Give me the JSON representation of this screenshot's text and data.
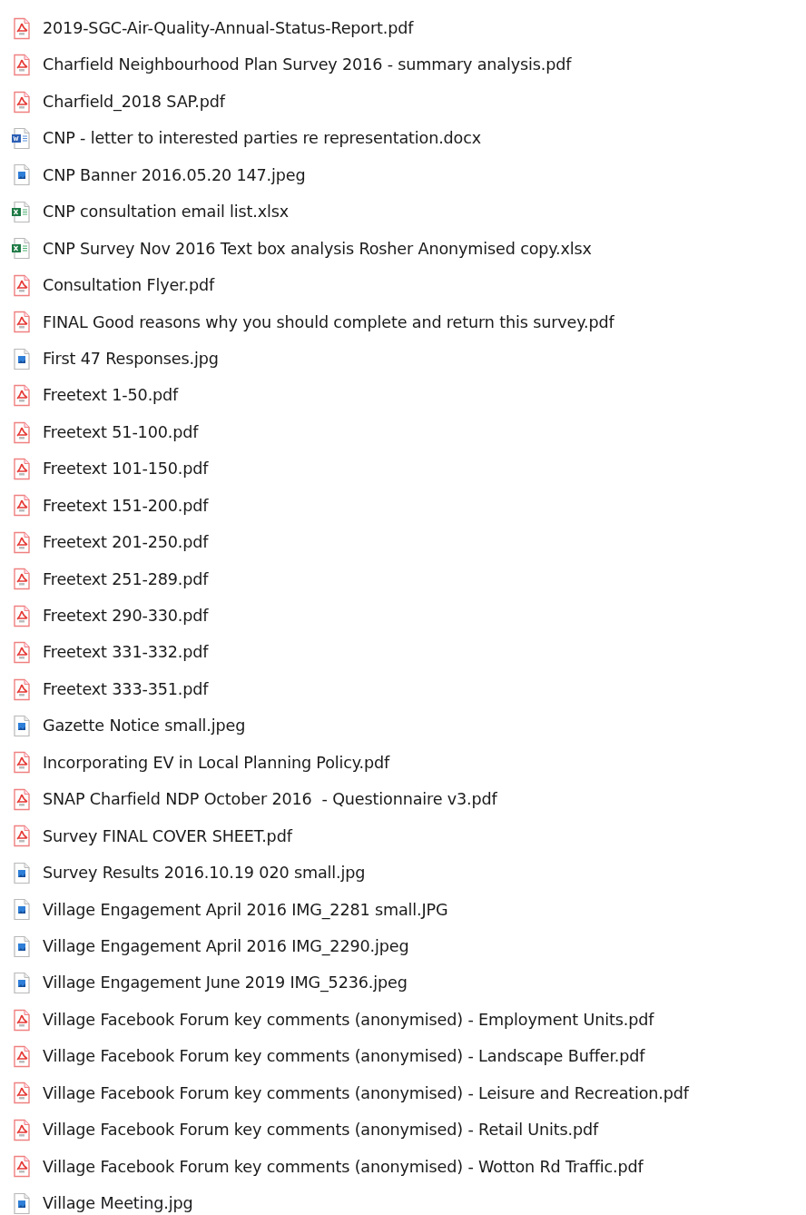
{
  "files": [
    {
      "name": "2019-SGC-Air-Quality-Annual-Status-Report.pdf",
      "kind": "pdf"
    },
    {
      "name": "Charfield Neighbourhood Plan Survey 2016 - summary analysis.pdf",
      "kind": "pdf"
    },
    {
      "name": "Charfield_2018 SAP.pdf",
      "kind": "pdf"
    },
    {
      "name": "CNP - letter to interested parties re representation.docx",
      "kind": "word"
    },
    {
      "name": "CNP Banner 2016.05.20 147.jpeg",
      "kind": "image"
    },
    {
      "name": "CNP consultation email list.xlsx",
      "kind": "excel"
    },
    {
      "name": "CNP Survey Nov 2016 Text box analysis Rosher Anonymised copy.xlsx",
      "kind": "excel"
    },
    {
      "name": "Consultation Flyer.pdf",
      "kind": "pdf"
    },
    {
      "name": "FINAL Good reasons why you should complete and return this survey.pdf",
      "kind": "pdf"
    },
    {
      "name": "First 47 Responses.jpg",
      "kind": "image"
    },
    {
      "name": "Freetext 1-50.pdf",
      "kind": "pdf"
    },
    {
      "name": "Freetext 51-100.pdf",
      "kind": "pdf"
    },
    {
      "name": "Freetext 101-150.pdf",
      "kind": "pdf"
    },
    {
      "name": "Freetext 151-200.pdf",
      "kind": "pdf"
    },
    {
      "name": "Freetext 201-250.pdf",
      "kind": "pdf"
    },
    {
      "name": "Freetext 251-289.pdf",
      "kind": "pdf"
    },
    {
      "name": "Freetext 290-330.pdf",
      "kind": "pdf"
    },
    {
      "name": "Freetext 331-332.pdf",
      "kind": "pdf"
    },
    {
      "name": "Freetext 333-351.pdf",
      "kind": "pdf"
    },
    {
      "name": "Gazette Notice small.jpeg",
      "kind": "image"
    },
    {
      "name": "Incorporating EV in Local Planning Policy.pdf",
      "kind": "pdf"
    },
    {
      "name": "SNAP Charfield NDP October 2016  - Questionnaire v3.pdf",
      "kind": "pdf"
    },
    {
      "name": "Survey FINAL COVER SHEET.pdf",
      "kind": "pdf"
    },
    {
      "name": "Survey Results 2016.10.19 020 small.jpg",
      "kind": "image"
    },
    {
      "name": "Village Engagement April 2016 IMG_2281 small.JPG",
      "kind": "image"
    },
    {
      "name": "Village Engagement April 2016 IMG_2290.jpeg",
      "kind": "image"
    },
    {
      "name": "Village Engagement June 2019 IMG_5236.jpeg",
      "kind": "image"
    },
    {
      "name": "Village Facebook Forum key comments (anonymised) - Employment Units.pdf",
      "kind": "pdf"
    },
    {
      "name": "Village Facebook Forum key comments (anonymised) - Landscape Buffer.pdf",
      "kind": "pdf"
    },
    {
      "name": "Village Facebook Forum key comments (anonymised) - Leisure and Recreation.pdf",
      "kind": "pdf"
    },
    {
      "name": "Village Facebook Forum key comments (anonymised) - Retail Units.pdf",
      "kind": "pdf"
    },
    {
      "name": "Village Facebook Forum key comments (anonymised) - Wotton Rd Traffic.pdf",
      "kind": "pdf"
    },
    {
      "name": "Village Meeting.jpg",
      "kind": "image"
    }
  ]
}
